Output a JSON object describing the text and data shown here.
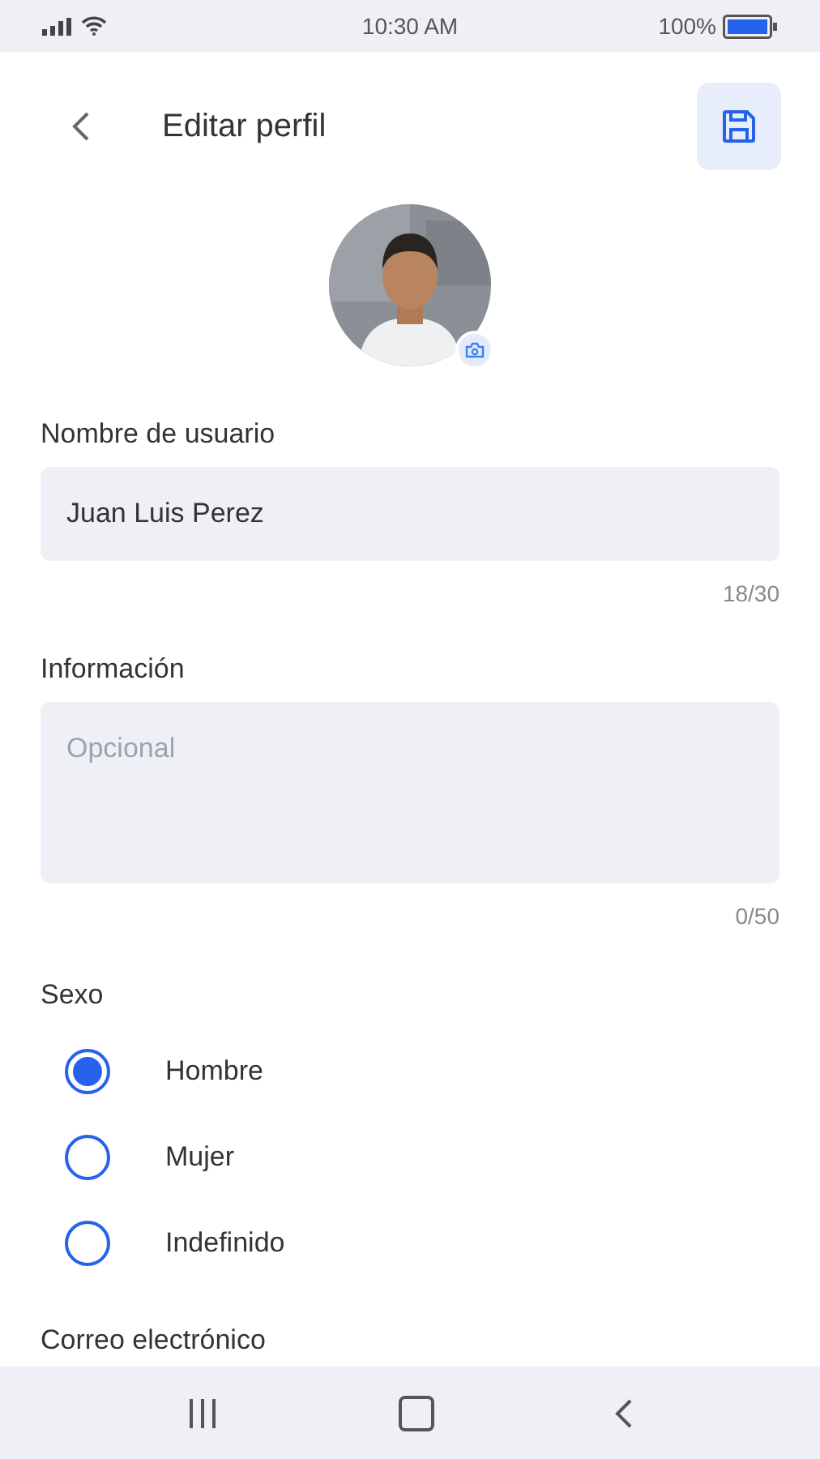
{
  "status_bar": {
    "time": "10:30 AM",
    "battery": "100%"
  },
  "header": {
    "title": "Editar perfil"
  },
  "fields": [
    {
      "label": "Nombre de usuario",
      "value": "Juan Luis Perez",
      "counter": "18/30",
      "multiline": false
    },
    {
      "label": "Información",
      "placeholder": "Opcional",
      "counter": "0/50",
      "multiline": true
    }
  ],
  "gender": {
    "label": "Sexo",
    "options": [
      {
        "label": "Hombre",
        "selected": true
      },
      {
        "label": "Mujer",
        "selected": false
      },
      {
        "label": "Indefinido",
        "selected": false
      }
    ]
  },
  "next_label": "Correo electrónico"
}
